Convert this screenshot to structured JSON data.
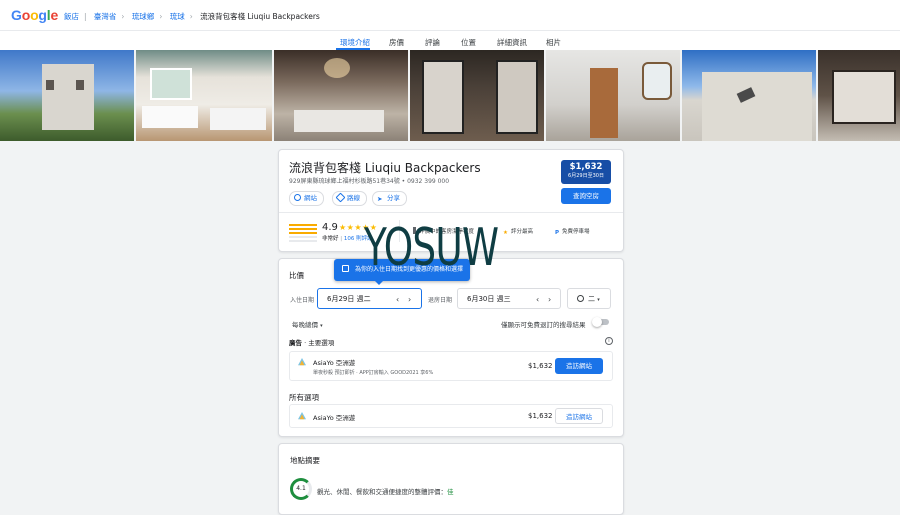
{
  "header": {
    "logo": "Google",
    "breadcrumbs": [
      "飯店",
      "臺灣省",
      "琉球鄉",
      "琉球"
    ],
    "current": "流浪背包客棧 Liuqiu Backpackers"
  },
  "tabs": [
    "環境介紹",
    "房價",
    "評論",
    "位置",
    "詳細資訊",
    "相片"
  ],
  "hotel": {
    "name": "流浪背包客棧 Liuqiu Backpackers",
    "address": "929屏東縣琉球鄉上福村杉板路51巷34號 • 0932 399 000",
    "actions": [
      "網站",
      "路線",
      "分享"
    ],
    "price": "$1,632",
    "price_dates": "6月29日至30日",
    "check_button": "查詢空房",
    "rating": "4.9",
    "stars": "★★★★★",
    "rating_label": "非常好",
    "review_count": "106 則評論",
    "features": [
      "評價中的客房潔淨程度",
      "評分最高",
      "免費停車場"
    ]
  },
  "prices": {
    "title": "比價",
    "tooltip": "為你的入住日期找到更優惠的價格和選擇",
    "checkin_label": "入住日期",
    "checkin_value": "6月29日 週二",
    "checkout_label": "退房日期",
    "checkout_value": "6月30日 週三",
    "guests": "二",
    "nightly_label": "每晚總價",
    "free_cancel_label": "僅顯示可免費退訂的搜尋結果",
    "ads_label": "廣告",
    "ads_sub": "主要選項",
    "ad_offer": {
      "provider": "AsiaYo 亞洲遊",
      "detail": "單夜秒殺 預訂即折 · APP訂房輸入 GOOD2021 享6%",
      "price": "$1,632",
      "button": "造訪網站"
    },
    "all_label": "所有選項",
    "all_offer": {
      "provider": "AsiaYo 亞洲遊",
      "price": "$1,632",
      "button": "造訪網站"
    }
  },
  "location": {
    "title": "地點摘要",
    "score": "4.1",
    "desc_prefix": "觀光、休閒、餐飲和交通便捷度的整體評價：",
    "desc_highlight": "佳"
  },
  "watermark": "YOSUW",
  "colors": {
    "accent": "#1a73e8",
    "price_box": "#174ea6",
    "star": "#fbbc04",
    "score": "#1e8e3e"
  }
}
